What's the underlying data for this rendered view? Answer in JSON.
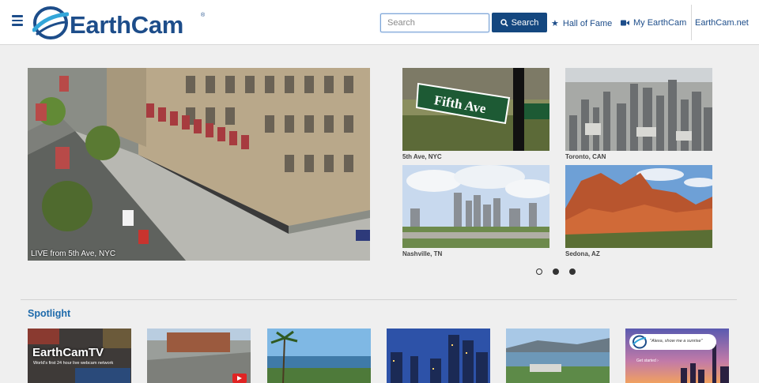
{
  "header": {
    "logo_text": "EarthCam",
    "logo_reg": "®",
    "search_placeholder": "Search",
    "search_button": "Search",
    "nav": {
      "hall_of_fame": "Hall of Fame",
      "my_earthcam": "My EarthCam",
      "earthcam_net": "EarthCam.net"
    }
  },
  "hero": {
    "caption": "LIVE from 5th Ave, NYC"
  },
  "grid": [
    {
      "caption": "5th Ave, NYC",
      "sign": "Fifth Ave"
    },
    {
      "caption": "Toronto, CAN"
    },
    {
      "caption": "Nashville, TN"
    },
    {
      "caption": "Sedona, AZ"
    }
  ],
  "carousel": {
    "pages": 3,
    "active": 0
  },
  "spotlight": {
    "title": "Spotlight",
    "tv_title": "EarthCamTV",
    "tv_subtitle": "World's first 24 hour live webcam network",
    "alexa_quote": "\"Alexa, show me a sunrise\"",
    "alexa_cta": "Get started ›"
  },
  "colors": {
    "brand": "#1d4d8a",
    "button": "#14477f",
    "background": "#efefef"
  }
}
